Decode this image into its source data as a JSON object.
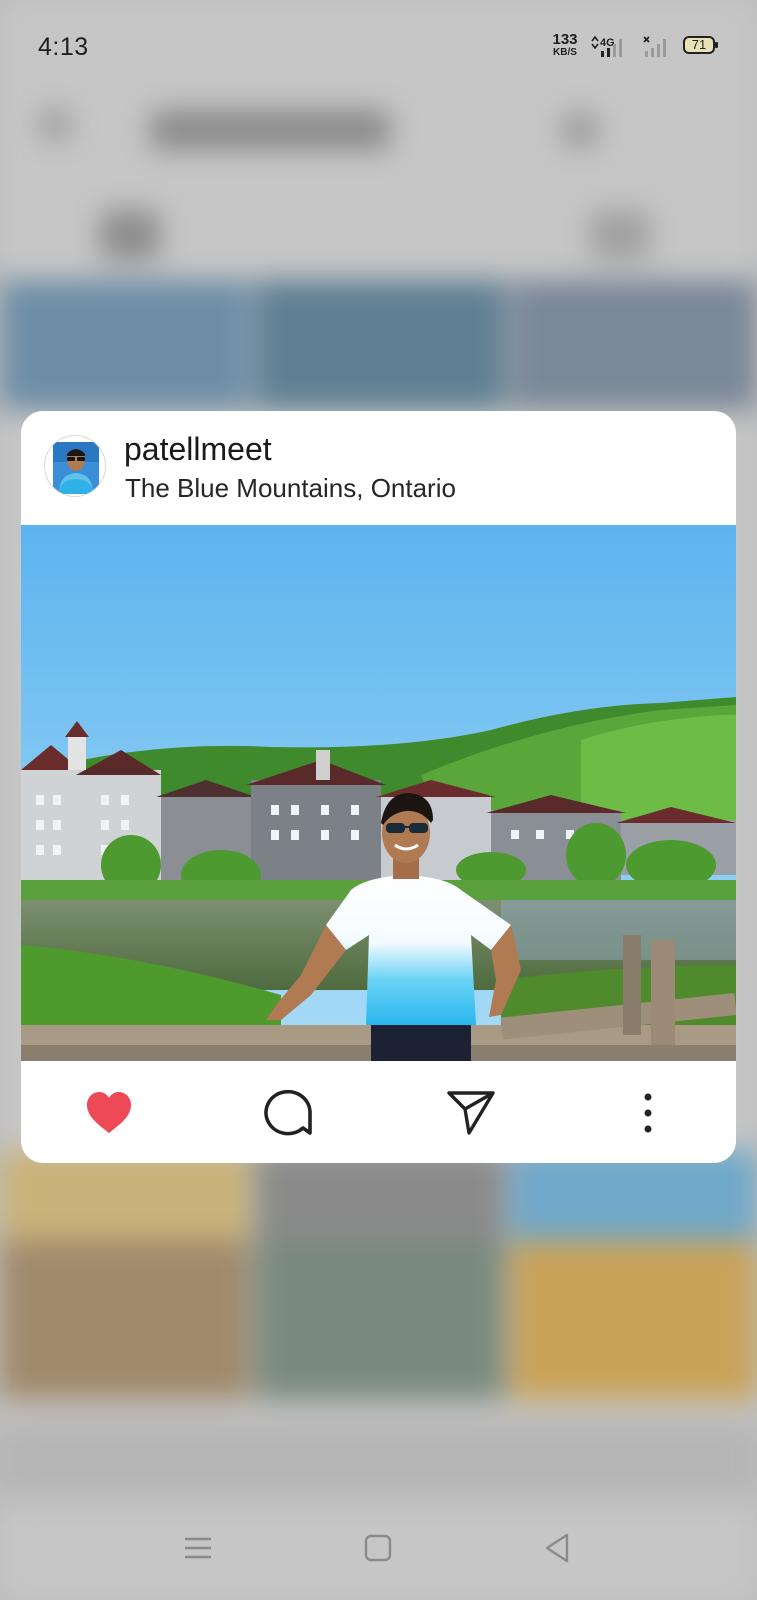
{
  "status_bar": {
    "time": "4:13",
    "net_speed_value": "133",
    "net_speed_unit": "KB/S",
    "network_type": "4G",
    "battery_level": "71"
  },
  "post": {
    "username": "patellmeet",
    "location": "The Blue Mountains, Ontario",
    "liked": true,
    "like_color": "#ED4956"
  },
  "actions": {
    "icons": [
      "heart-icon",
      "comment-icon",
      "send-icon",
      "more-vertical-icon"
    ]
  },
  "nav_bar": {
    "icons": [
      "menu-icon",
      "home-square-icon",
      "back-triangle-icon"
    ]
  }
}
